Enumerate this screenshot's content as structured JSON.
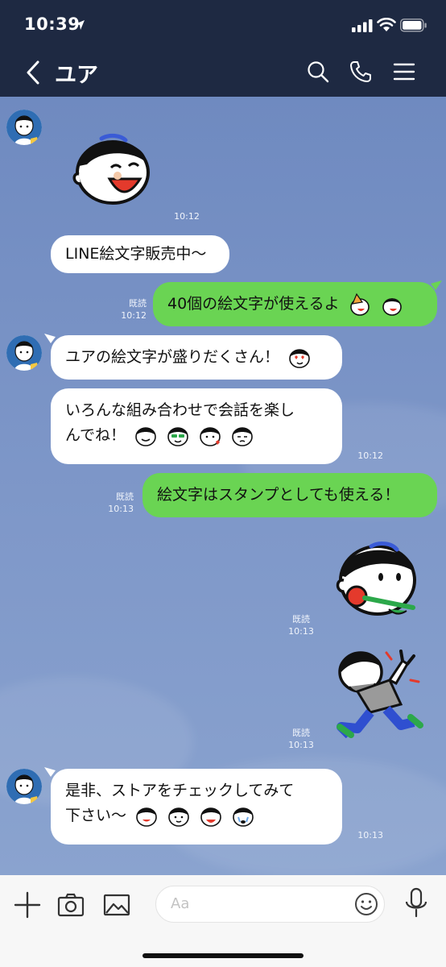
{
  "status_bar": {
    "time": "10:39"
  },
  "header": {
    "title": "ユア"
  },
  "messages": [
    {
      "time": "10:12"
    },
    {
      "text": "LINE絵文字販売中〜"
    },
    {
      "text": "40個の絵文字が使えるよ",
      "read": "既読",
      "time": "10:12"
    },
    {
      "text": "ユアの絵文字が盛りだくさん！"
    },
    {
      "line1": "いろんな組み合わせで会話を楽し",
      "line2": "んでね！",
      "time": "10:12"
    },
    {
      "text": "絵文字はスタンプとしても使える！",
      "read": "既読",
      "time": "10:13"
    },
    {
      "read": "既読",
      "time": "10:13"
    },
    {
      "read": "既読",
      "time": "10:13"
    },
    {
      "line1": "是非、ストアをチェックしてみて",
      "line2": "下さい〜",
      "time": "10:13"
    }
  ],
  "input": {
    "placeholder": "Aa"
  },
  "colors": {
    "header_bg": "#1e2942",
    "chat_bg": "#7590c4",
    "outgoing_bubble": "#6ad453",
    "incoming_bubble": "#ffffff"
  },
  "icons": [
    "back-icon",
    "search-icon",
    "phone-icon",
    "menu-icon",
    "plus-icon",
    "camera-icon",
    "image-icon",
    "smiley-icon",
    "mic-icon"
  ]
}
